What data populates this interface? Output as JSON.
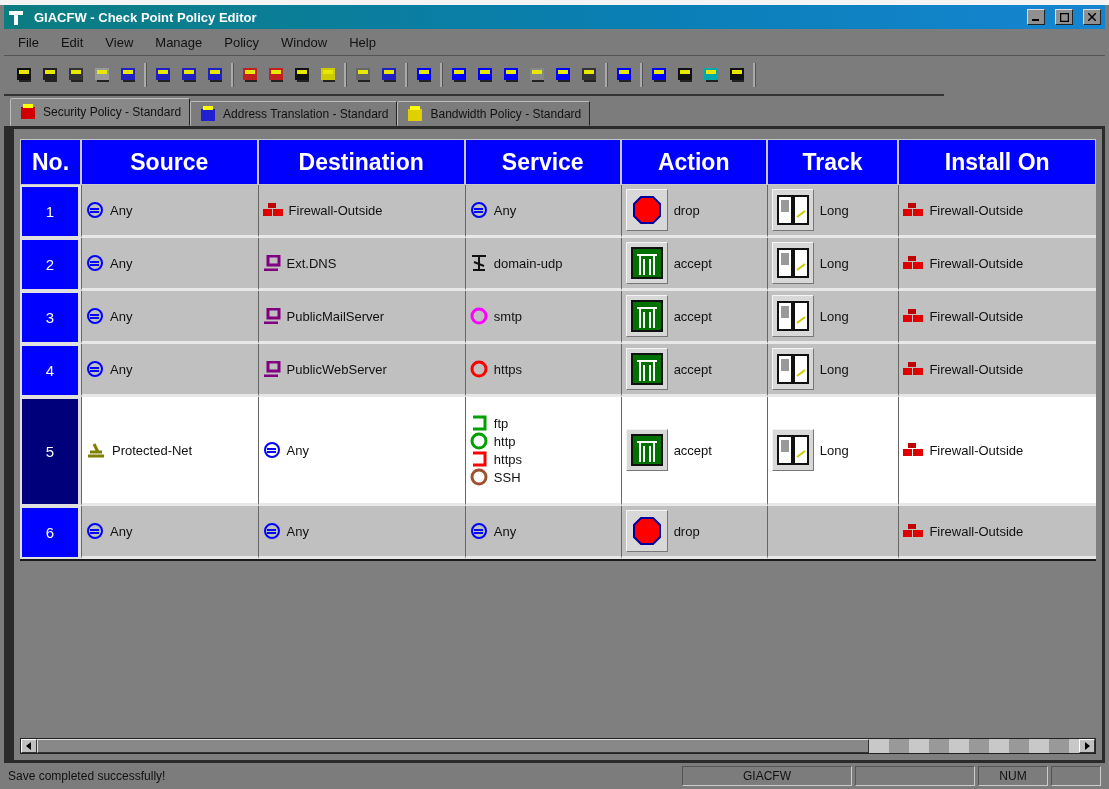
{
  "window": {
    "title": "GIACFW - Check Point Policy Editor"
  },
  "menu": [
    "File",
    "Edit",
    "View",
    "Manage",
    "Policy",
    "Window",
    "Help"
  ],
  "tabs": [
    {
      "label": "Security Policy - Standard",
      "selected": true,
      "kind": "security"
    },
    {
      "label": "Address Translation - Standard",
      "selected": false,
      "kind": "nat"
    },
    {
      "label": "Bandwidth Policy - Standard",
      "selected": false,
      "kind": "bandwidth"
    }
  ],
  "table": {
    "columns": [
      "No.",
      "Source",
      "Destination",
      "Service",
      "Action",
      "Track",
      "Install On"
    ],
    "rows": [
      {
        "number": "1",
        "selected": false,
        "source": [
          {
            "kind": "any",
            "text": "Any"
          }
        ],
        "destination": [
          {
            "kind": "gateway",
            "text": "Firewall-Outside"
          }
        ],
        "service": [
          {
            "kind": "any",
            "text": "Any"
          }
        ],
        "action": {
          "kind": "drop",
          "text": "drop"
        },
        "track": {
          "text": "Long"
        },
        "install_on": [
          {
            "kind": "gateway",
            "text": "Firewall-Outside"
          }
        ]
      },
      {
        "number": "2",
        "selected": false,
        "source": [
          {
            "kind": "any",
            "text": "Any"
          }
        ],
        "destination": [
          {
            "kind": "host",
            "text": "Ext.DNS"
          }
        ],
        "service": [
          {
            "kind": "udp",
            "text": "domain-udp"
          }
        ],
        "action": {
          "kind": "accept",
          "text": "accept"
        },
        "track": {
          "text": "Long"
        },
        "install_on": [
          {
            "kind": "gateway",
            "text": "Firewall-Outside"
          }
        ]
      },
      {
        "number": "3",
        "selected": false,
        "source": [
          {
            "kind": "any",
            "text": "Any"
          }
        ],
        "destination": [
          {
            "kind": "host",
            "text": "PublicMailServer"
          }
        ],
        "service": [
          {
            "kind": "tcp",
            "text": "smtp",
            "color": "#ff00ff"
          }
        ],
        "action": {
          "kind": "accept",
          "text": "accept"
        },
        "track": {
          "text": "Long"
        },
        "install_on": [
          {
            "kind": "gateway",
            "text": "Firewall-Outside"
          }
        ]
      },
      {
        "number": "4",
        "selected": false,
        "source": [
          {
            "kind": "any",
            "text": "Any"
          }
        ],
        "destination": [
          {
            "kind": "host",
            "text": "PublicWebServer"
          }
        ],
        "service": [
          {
            "kind": "tcp",
            "text": "https",
            "color": "#ff0000"
          }
        ],
        "action": {
          "kind": "accept",
          "text": "accept"
        },
        "track": {
          "text": "Long"
        },
        "install_on": [
          {
            "kind": "gateway",
            "text": "Firewall-Outside"
          }
        ]
      },
      {
        "number": "5",
        "selected": true,
        "source": [
          {
            "kind": "network",
            "text": "Protected-Net"
          }
        ],
        "destination": [
          {
            "kind": "any",
            "text": "Any"
          }
        ],
        "service": [
          {
            "kind": "group",
            "text": "ftp",
            "color": "#00a000"
          },
          {
            "kind": "tcp",
            "text": "http",
            "color": "#00a000"
          },
          {
            "kind": "group",
            "text": "https",
            "color": "#ff0000"
          },
          {
            "kind": "tcp",
            "text": "SSH",
            "color": "#a05030"
          }
        ],
        "action": {
          "kind": "accept",
          "text": "accept"
        },
        "track": {
          "text": "Long"
        },
        "install_on": [
          {
            "kind": "gateway",
            "text": "Firewall-Outside"
          }
        ]
      },
      {
        "number": "6",
        "selected": false,
        "source": [
          {
            "kind": "any",
            "text": "Any"
          }
        ],
        "destination": [
          {
            "kind": "any",
            "text": "Any"
          }
        ],
        "service": [
          {
            "kind": "any",
            "text": "Any"
          }
        ],
        "action": {
          "kind": "drop",
          "text": "drop"
        },
        "install_on": [
          {
            "kind": "gateway",
            "text": "Firewall-Outside"
          }
        ]
      }
    ]
  },
  "status_bar": {
    "message": "Save completed successfully!",
    "firewall": "GIACFW",
    "keys": "NUM"
  }
}
